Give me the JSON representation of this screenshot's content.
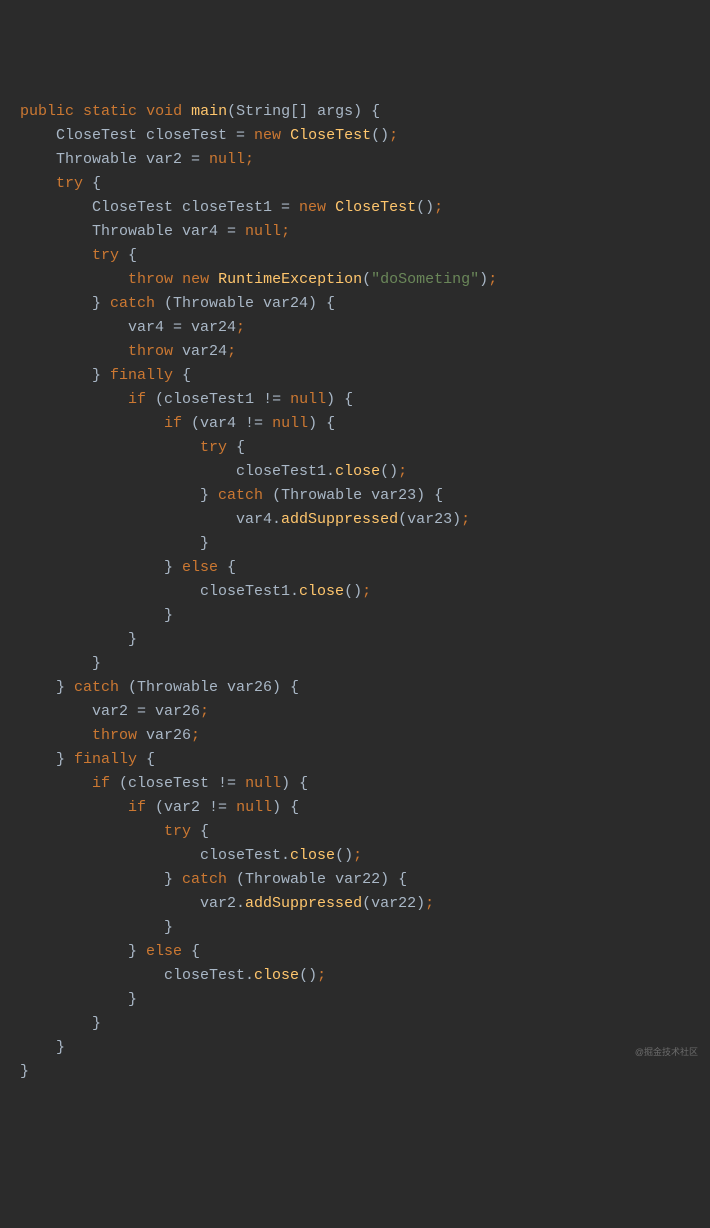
{
  "colors": {
    "background": "#2b2b2b",
    "keyword": "#cc7832",
    "identifier": "#a9b7c6",
    "method": "#ffc66d",
    "string": "#6a8759",
    "semicolon": "#cc7832"
  },
  "watermark": "@掘金技术社区",
  "code_tokens": [
    [
      [
        "k",
        "public"
      ],
      [
        "p",
        " "
      ],
      [
        "k",
        "static"
      ],
      [
        "p",
        " "
      ],
      [
        "k",
        "void"
      ],
      [
        "p",
        " "
      ],
      [
        "m",
        "main"
      ],
      [
        "p",
        "(String[] args) {"
      ]
    ],
    [
      [
        "p",
        "    CloseTest closeTest = "
      ],
      [
        "k",
        "new"
      ],
      [
        "p",
        " "
      ],
      [
        "m",
        "CloseTest"
      ],
      [
        "p",
        "()"
      ],
      [
        "sc",
        ";"
      ]
    ],
    [
      [
        "p",
        "    Throwable var2 = "
      ],
      [
        "k",
        "null"
      ],
      [
        "sc",
        ";"
      ]
    ],
    [
      [
        "p",
        ""
      ]
    ],
    [
      [
        "p",
        "    "
      ],
      [
        "k",
        "try"
      ],
      [
        "p",
        " {"
      ]
    ],
    [
      [
        "p",
        "        CloseTest closeTest1 = "
      ],
      [
        "k",
        "new"
      ],
      [
        "p",
        " "
      ],
      [
        "m",
        "CloseTest"
      ],
      [
        "p",
        "()"
      ],
      [
        "sc",
        ";"
      ]
    ],
    [
      [
        "p",
        "        Throwable var4 = "
      ],
      [
        "k",
        "null"
      ],
      [
        "sc",
        ";"
      ]
    ],
    [
      [
        "p",
        ""
      ]
    ],
    [
      [
        "p",
        "        "
      ],
      [
        "k",
        "try"
      ],
      [
        "p",
        " {"
      ]
    ],
    [
      [
        "p",
        "            "
      ],
      [
        "k",
        "throw"
      ],
      [
        "p",
        " "
      ],
      [
        "k",
        "new"
      ],
      [
        "p",
        " "
      ],
      [
        "m",
        "RuntimeException"
      ],
      [
        "p",
        "("
      ],
      [
        "s",
        "\"doSometing\""
      ],
      [
        "p",
        ")"
      ],
      [
        "sc",
        ";"
      ]
    ],
    [
      [
        "p",
        "        } "
      ],
      [
        "k",
        "catch"
      ],
      [
        "p",
        " (Throwable var24) {"
      ]
    ],
    [
      [
        "p",
        "            var4 = var24"
      ],
      [
        "sc",
        ";"
      ]
    ],
    [
      [
        "p",
        "            "
      ],
      [
        "k",
        "throw"
      ],
      [
        "p",
        " var24"
      ],
      [
        "sc",
        ";"
      ]
    ],
    [
      [
        "p",
        "        } "
      ],
      [
        "k",
        "finally"
      ],
      [
        "p",
        " {"
      ]
    ],
    [
      [
        "p",
        "            "
      ],
      [
        "k",
        "if"
      ],
      [
        "p",
        " (closeTest1 != "
      ],
      [
        "k",
        "null"
      ],
      [
        "p",
        ") {"
      ]
    ],
    [
      [
        "p",
        "                "
      ],
      [
        "k",
        "if"
      ],
      [
        "p",
        " (var4 != "
      ],
      [
        "k",
        "null"
      ],
      [
        "p",
        ") {"
      ]
    ],
    [
      [
        "p",
        "                    "
      ],
      [
        "k",
        "try"
      ],
      [
        "p",
        " {"
      ]
    ],
    [
      [
        "p",
        "                        closeTest1."
      ],
      [
        "m",
        "close"
      ],
      [
        "p",
        "()"
      ],
      [
        "sc",
        ";"
      ]
    ],
    [
      [
        "p",
        "                    } "
      ],
      [
        "k",
        "catch"
      ],
      [
        "p",
        " (Throwable var23) {"
      ]
    ],
    [
      [
        "p",
        "                        var4."
      ],
      [
        "m",
        "addSuppressed"
      ],
      [
        "p",
        "(var23)"
      ],
      [
        "sc",
        ";"
      ]
    ],
    [
      [
        "p",
        "                    }"
      ]
    ],
    [
      [
        "p",
        "                } "
      ],
      [
        "k",
        "else"
      ],
      [
        "p",
        " {"
      ]
    ],
    [
      [
        "p",
        "                    closeTest1."
      ],
      [
        "m",
        "close"
      ],
      [
        "p",
        "()"
      ],
      [
        "sc",
        ";"
      ]
    ],
    [
      [
        "p",
        "                }"
      ]
    ],
    [
      [
        "p",
        "            }"
      ]
    ],
    [
      [
        "p",
        ""
      ]
    ],
    [
      [
        "p",
        "        }"
      ]
    ],
    [
      [
        "p",
        "    } "
      ],
      [
        "k",
        "catch"
      ],
      [
        "p",
        " (Throwable var26) {"
      ]
    ],
    [
      [
        "p",
        "        var2 = var26"
      ],
      [
        "sc",
        ";"
      ]
    ],
    [
      [
        "p",
        "        "
      ],
      [
        "k",
        "throw"
      ],
      [
        "p",
        " var26"
      ],
      [
        "sc",
        ";"
      ]
    ],
    [
      [
        "p",
        "    } "
      ],
      [
        "k",
        "finally"
      ],
      [
        "p",
        " {"
      ]
    ],
    [
      [
        "p",
        "        "
      ],
      [
        "k",
        "if"
      ],
      [
        "p",
        " (closeTest != "
      ],
      [
        "k",
        "null"
      ],
      [
        "p",
        ") {"
      ]
    ],
    [
      [
        "p",
        "            "
      ],
      [
        "k",
        "if"
      ],
      [
        "p",
        " (var2 != "
      ],
      [
        "k",
        "null"
      ],
      [
        "p",
        ") {"
      ]
    ],
    [
      [
        "p",
        "                "
      ],
      [
        "k",
        "try"
      ],
      [
        "p",
        " {"
      ]
    ],
    [
      [
        "p",
        "                    closeTest."
      ],
      [
        "m",
        "close"
      ],
      [
        "p",
        "()"
      ],
      [
        "sc",
        ";"
      ]
    ],
    [
      [
        "p",
        "                } "
      ],
      [
        "k",
        "catch"
      ],
      [
        "p",
        " (Throwable var22) {"
      ]
    ],
    [
      [
        "p",
        "                    var2."
      ],
      [
        "m",
        "addSuppressed"
      ],
      [
        "p",
        "(var22)"
      ],
      [
        "sc",
        ";"
      ]
    ],
    [
      [
        "p",
        "                }"
      ]
    ],
    [
      [
        "p",
        "            } "
      ],
      [
        "k",
        "else"
      ],
      [
        "p",
        " {"
      ]
    ],
    [
      [
        "p",
        "                closeTest."
      ],
      [
        "m",
        "close"
      ],
      [
        "p",
        "()"
      ],
      [
        "sc",
        ";"
      ]
    ],
    [
      [
        "p",
        "            }"
      ]
    ],
    [
      [
        "p",
        "        }"
      ]
    ],
    [
      [
        "p",
        ""
      ]
    ],
    [
      [
        "p",
        "    }"
      ]
    ],
    [
      [
        "p",
        "}"
      ]
    ]
  ]
}
